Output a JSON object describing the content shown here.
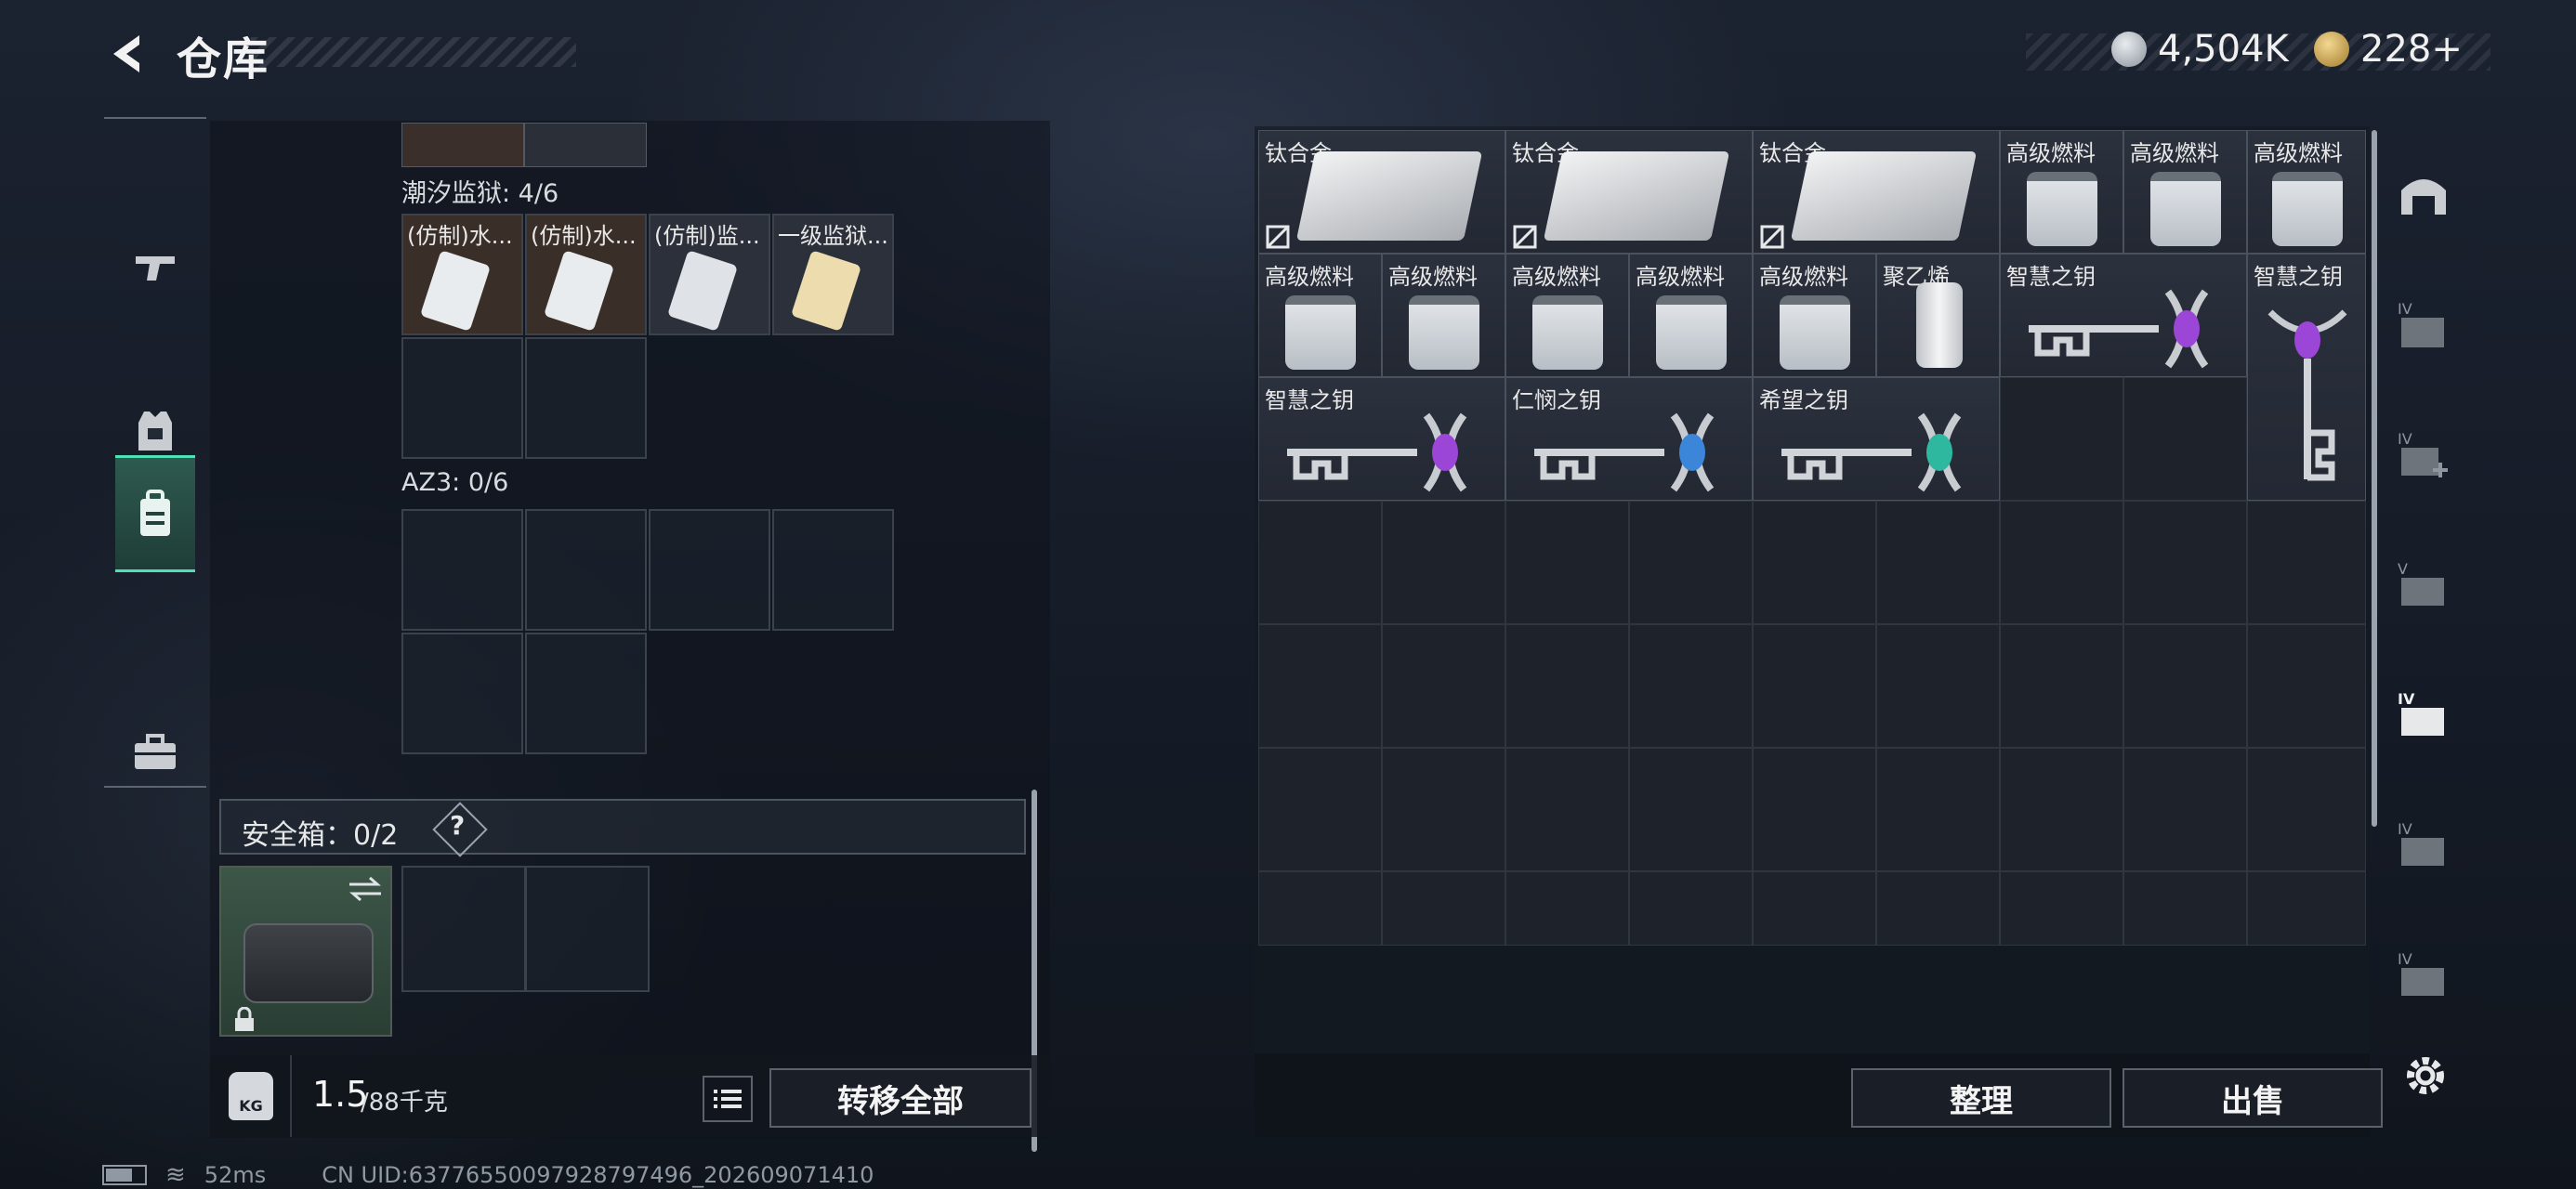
{
  "header": {
    "title": "仓库",
    "back_icon": "back-arrow-icon"
  },
  "currency": {
    "silver": "4,504K",
    "gold": "228+",
    "silver_color": "#a9b0b8",
    "gold_color": "#c8a45a"
  },
  "left_nav": {
    "items": [
      {
        "name": "weapons",
        "icon": "pistol-icon"
      },
      {
        "name": "armor",
        "icon": "vest-icon"
      },
      {
        "name": "backpack",
        "icon": "backpack-icon",
        "selected": true
      },
      {
        "name": "case",
        "icon": "briefcase-icon"
      }
    ]
  },
  "containers": [
    {
      "label": "潮汐监狱: 4/6",
      "items": [
        {
          "name": "(仿制)水..."
        },
        {
          "name": "(仿制)水..."
        },
        {
          "name": "(仿制)监..."
        },
        {
          "name": "一级监狱..."
        }
      ]
    },
    {
      "label": "AZ3: 0/6"
    }
  ],
  "safe_box": {
    "label": "安全箱：0/2",
    "help": "?"
  },
  "footer_left": {
    "weight": "1.5",
    "weight_capacity": "/88千克",
    "kg_badge": "KG",
    "transfer_all": "转移全部"
  },
  "right_items": [
    "钛合金",
    "钛合金",
    "钛合金",
    "高级燃料",
    "高级燃料",
    "高级燃料",
    "高级燃料",
    "高级燃料",
    "高级燃料",
    "高级燃料",
    "高级燃料",
    "聚乙烯",
    "智慧之钥",
    "智慧之钥",
    "智慧之钥",
    "仁悯之钥",
    "希望之钥"
  ],
  "right_footer": {
    "sort": "整理",
    "sell": "出售"
  },
  "right_nav": {
    "icons": [
      "vault-icon",
      "storage-iv-icon",
      "storage-iv-plus-icon",
      "storage-v-icon",
      "storage-iv-hand-icon",
      "storage-iv-card-icon",
      "storage-iv-gear-icon",
      "settings-gear-icon"
    ]
  },
  "status": {
    "ping": "52ms",
    "uid": "CN UID:63776550097928797496_202609071410"
  }
}
